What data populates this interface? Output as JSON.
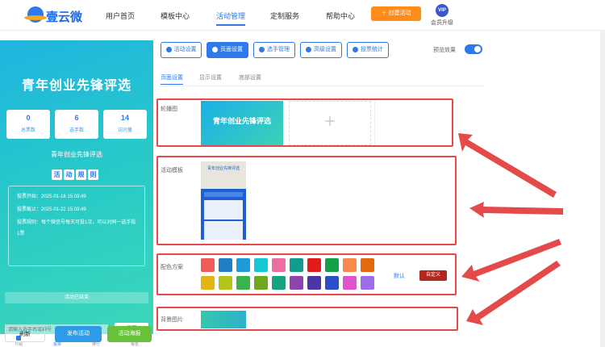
{
  "brand": {
    "name": "壹云微"
  },
  "nav": [
    "用户首页",
    "模板中心",
    "活动管理",
    "定制服务",
    "帮助中心"
  ],
  "nav_active": "活动管理",
  "header": {
    "create_label": "创建活动",
    "vip_badge": "VIP",
    "vip_label": "会员升级"
  },
  "phone": {
    "banner_title": "青年创业先锋评选",
    "stats": [
      {
        "value": "0",
        "label": "总票数"
      },
      {
        "value": "6",
        "label": "选手数"
      },
      {
        "value": "14",
        "label": "访问量"
      }
    ],
    "subtitle": "青年创业先锋评选",
    "rules_title": [
      "活",
      "动",
      "规",
      "则"
    ],
    "rules": [
      "投票开始：2025-01-16 15:03:49",
      "投票截止：2025-01-22 15:03:49",
      "投票规则：每个微信号每天可投1次，可以对同一选手投1票"
    ],
    "ended": "活动已结束",
    "search_placeholder": "请输入选手名或编号",
    "search_label": "搜索",
    "tabs": [
      "介绍",
      "投票",
      "排行",
      "报名"
    ]
  },
  "bottom_buttons": {
    "refresh": "刷新",
    "publish": "发布活动",
    "poster": "活动海报"
  },
  "settings_tabs": [
    "活动设置",
    "页面设置",
    "选手管理",
    "高级设置",
    "投票统计"
  ],
  "settings_active": "页面设置",
  "preview_label": "预览效果",
  "preview_on": true,
  "subtabs": [
    "页面设置",
    "显示设置",
    "底部设置"
  ],
  "sections": {
    "carousel": "轮播图",
    "template": "活动模板",
    "color": "配色方案",
    "background": "背景图片"
  },
  "carousel_banner_text": "青年创业先锋评选",
  "template_header": "青年创业先锋评选",
  "colors": [
    "#f25a5a",
    "#1f7fc4",
    "#1f9bd8",
    "#15c8d8",
    "#ea6fa0",
    "#129b8f",
    "#e21b1b",
    "#16a04a",
    "#f7894a",
    "#e2690d",
    "#e3b513",
    "#b3c41c",
    "#3cb24c",
    "#6fa81f",
    "#14a37f",
    "#8e44ad",
    "#4a36a8",
    "#2b4fc7",
    "#e055cc",
    "#9b6de8"
  ],
  "default_label": "默认",
  "custom_label": "自定义",
  "accent_colors": {
    "primary": "#2f79e8",
    "orange": "#ff8c1a",
    "highlight": "#e44a4a"
  }
}
